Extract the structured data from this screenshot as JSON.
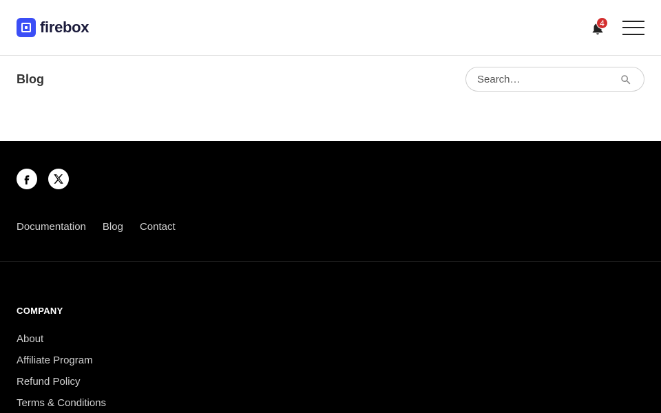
{
  "header": {
    "brand": "firebox",
    "brand_color": "#3b4ef6",
    "notification_count": "4",
    "notification_icon": "bell-icon",
    "menu_icon": "hamburger-menu-icon"
  },
  "main": {
    "title": "Blog",
    "search": {
      "placeholder": "Search…",
      "icon": "search-icon"
    }
  },
  "footer": {
    "social": [
      {
        "name": "facebook",
        "icon": "facebook-icon"
      },
      {
        "name": "x",
        "icon": "x-icon"
      }
    ],
    "nav": [
      "Documentation",
      "Blog",
      "Contact"
    ],
    "company": {
      "heading": "COMPANY",
      "links": [
        "About",
        "Affiliate Program",
        "Refund Policy",
        "Terms & Conditions"
      ]
    }
  }
}
